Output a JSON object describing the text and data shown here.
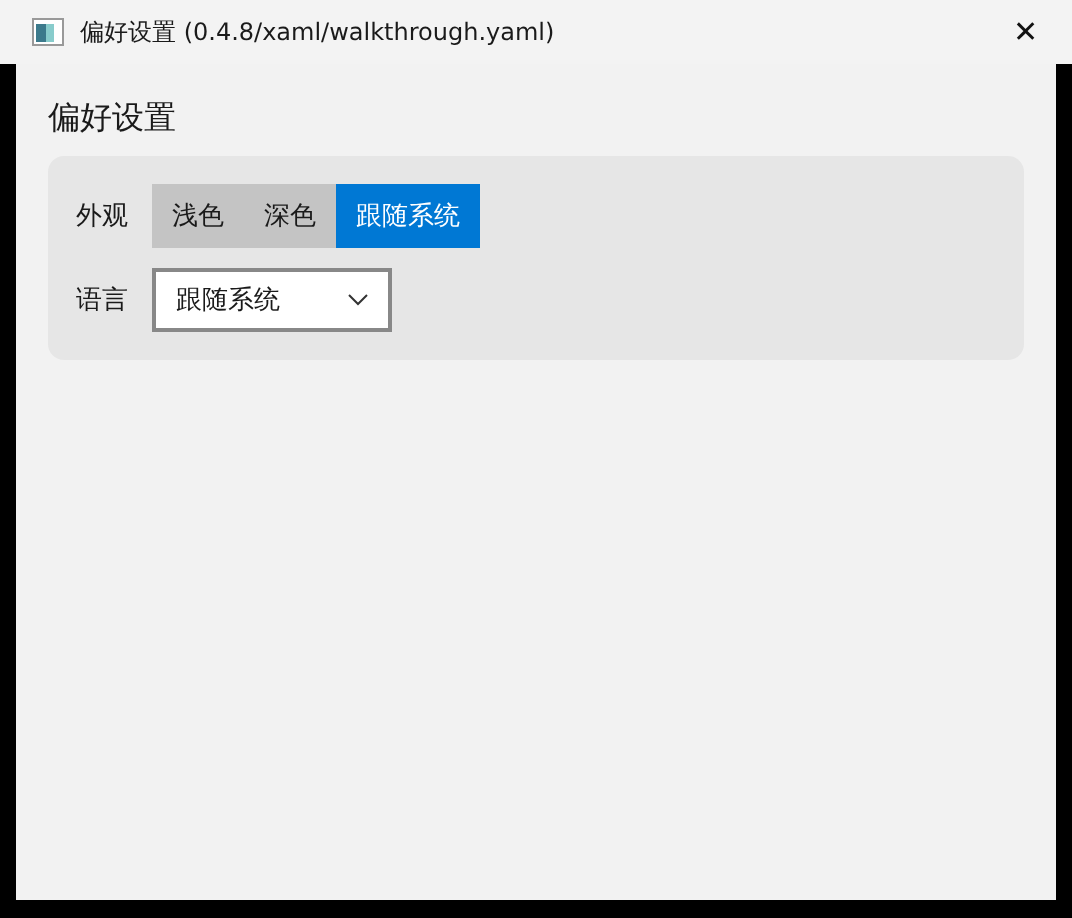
{
  "window": {
    "title": "偏好设置 (0.4.8/xaml/walkthrough.yaml)",
    "close": "✕"
  },
  "heading": "偏好设置",
  "settings": [
    {
      "kind": "segmented",
      "label": "外观",
      "options": [
        {
          "label": "浅色",
          "selected": false
        },
        {
          "label": "深色",
          "selected": false
        },
        {
          "label": "跟随系统",
          "selected": true
        }
      ]
    },
    {
      "kind": "dropdown",
      "label": "语言",
      "value": "跟随系统"
    }
  ]
}
